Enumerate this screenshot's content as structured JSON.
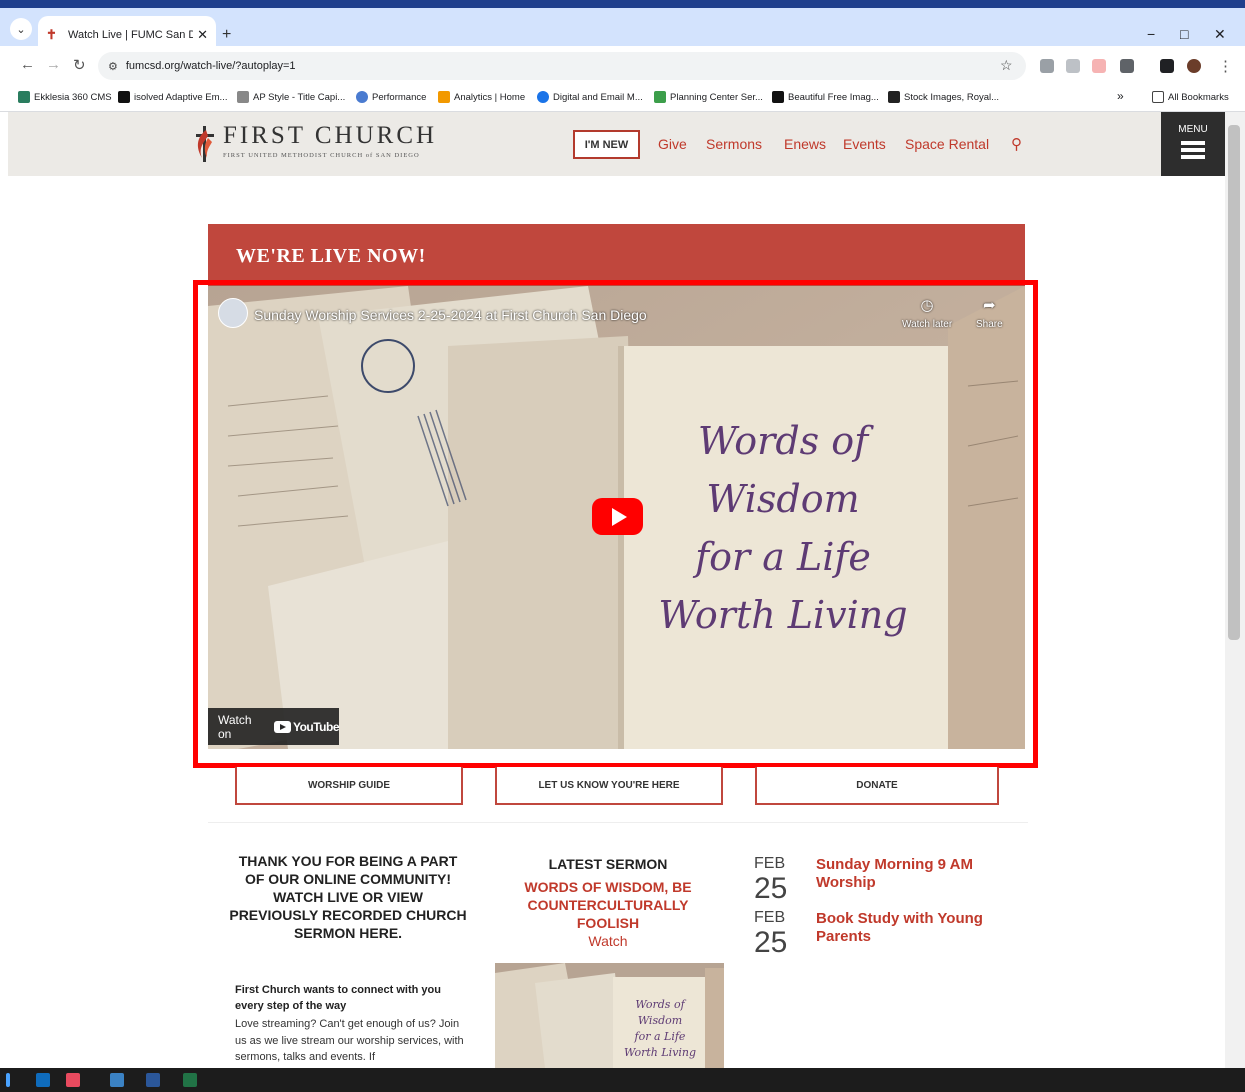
{
  "browser": {
    "tab_title": "Watch Live | FUMC San Diego",
    "new_tab": "+",
    "url": "fumcsd.org/watch-live/?autoplay=1",
    "window_controls": {
      "minimize": "−",
      "maximize": "□",
      "close": "✕"
    },
    "bookmarks": [
      {
        "label": "Ekklesia 360 CMS",
        "color": "#2a7d5f"
      },
      {
        "label": "isolved Adaptive Em...",
        "color": "#111111"
      },
      {
        "label": "AP Style - Title Capi...",
        "color": "#888888"
      },
      {
        "label": "Performance",
        "color": "#4a7bd0"
      },
      {
        "label": "Analytics | Home",
        "color": "#f29900"
      },
      {
        "label": "Digital and Email M...",
        "color": "#1a73e8"
      },
      {
        "label": "Planning Center Ser...",
        "color": "#3c9e4a"
      },
      {
        "label": "Beautiful Free Imag...",
        "color": "#111111"
      },
      {
        "label": "Stock Images, Royal...",
        "color": "#222222"
      }
    ],
    "bookmarks_overflow": "»",
    "all_bookmarks": "All Bookmarks"
  },
  "site": {
    "logo_title": "FIRST CHURCH",
    "logo_sub": "FIRST UNITED METHODIST CHURCH of SAN DIEGO",
    "im_new": "I'M NEW",
    "nav": [
      "Give",
      "Sermons",
      "Enews",
      "Events",
      "Space Rental"
    ],
    "menu_label": "MENU",
    "accent": "#c0392b"
  },
  "live": {
    "banner": "WE'RE LIVE NOW!",
    "video_title": "Sunday Worship Services 2-25-2024 at First Church San Diego",
    "watch_later": "Watch later",
    "share": "Share",
    "watch_on": "Watch on",
    "youtube": "YouTube",
    "art_lines": [
      "Words of",
      "Wisdom",
      "for a Life",
      "Worth Living"
    ]
  },
  "buttons": [
    "WORSHIP GUIDE",
    "LET US KNOW YOU'RE HERE",
    "DONATE"
  ],
  "community": {
    "heading": "THANK YOU FOR BEING A PART OF OUR ONLINE COMMUNITY! WATCH LIVE OR VIEW PREVIOUSLY RECORDED CHURCH SERMON HERE.",
    "connect_heading": "First Church wants to connect with you every step of the way",
    "connect_body": "Love streaming? Can't get enough of us? Join us as we live stream our worship services, with sermons, talks and events. If"
  },
  "sermon": {
    "heading": "LATEST SERMON",
    "title": "WORDS OF WISDOM, BE COUNTERCULTURALLY FOOLISH",
    "watch": "Watch",
    "thumb_lines": [
      "Words of",
      "Wisdom",
      "for a Life",
      "Worth Living"
    ]
  },
  "events": [
    {
      "month": "FEB",
      "day": "25",
      "title": "Sunday Morning 9 AM Worship"
    },
    {
      "month": "FEB",
      "day": "25",
      "title": "Book Study with Young Parents"
    }
  ]
}
